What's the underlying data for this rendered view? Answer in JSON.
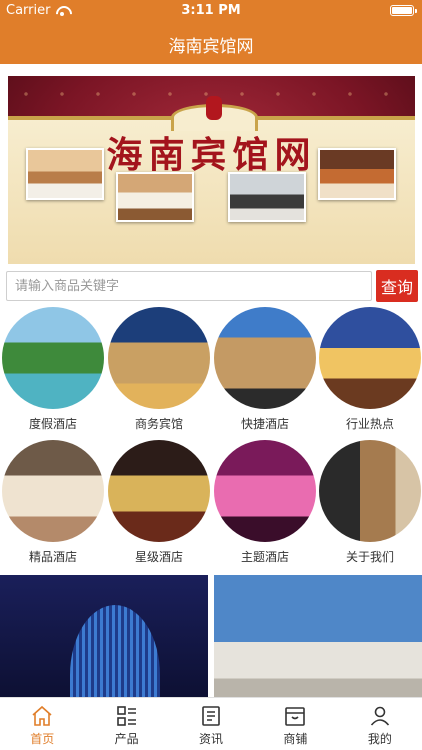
{
  "status_bar": {
    "carrier": "Carrier",
    "time": "3:11 PM"
  },
  "nav": {
    "title": "海南宾馆网"
  },
  "banner": {
    "title": "海南宾馆网"
  },
  "search": {
    "placeholder": "请输入商品关键字",
    "button_label": "查询"
  },
  "categories": [
    {
      "label": "度假酒店"
    },
    {
      "label": "商务宾馆"
    },
    {
      "label": "快捷酒店"
    },
    {
      "label": "行业热点"
    },
    {
      "label": "精品酒店"
    },
    {
      "label": "星级酒店"
    },
    {
      "label": "主题酒店"
    },
    {
      "label": "关于我们"
    }
  ],
  "tabs": [
    {
      "label": "首页",
      "icon": "home-icon",
      "active": true
    },
    {
      "label": "产品",
      "icon": "grid-list-icon",
      "active": false
    },
    {
      "label": "资讯",
      "icon": "news-icon",
      "active": false
    },
    {
      "label": "商铺",
      "icon": "store-icon",
      "active": false
    },
    {
      "label": "我的",
      "icon": "user-icon",
      "active": false
    }
  ],
  "colors": {
    "accent": "#e07e2a",
    "search_button": "#d92d20"
  }
}
